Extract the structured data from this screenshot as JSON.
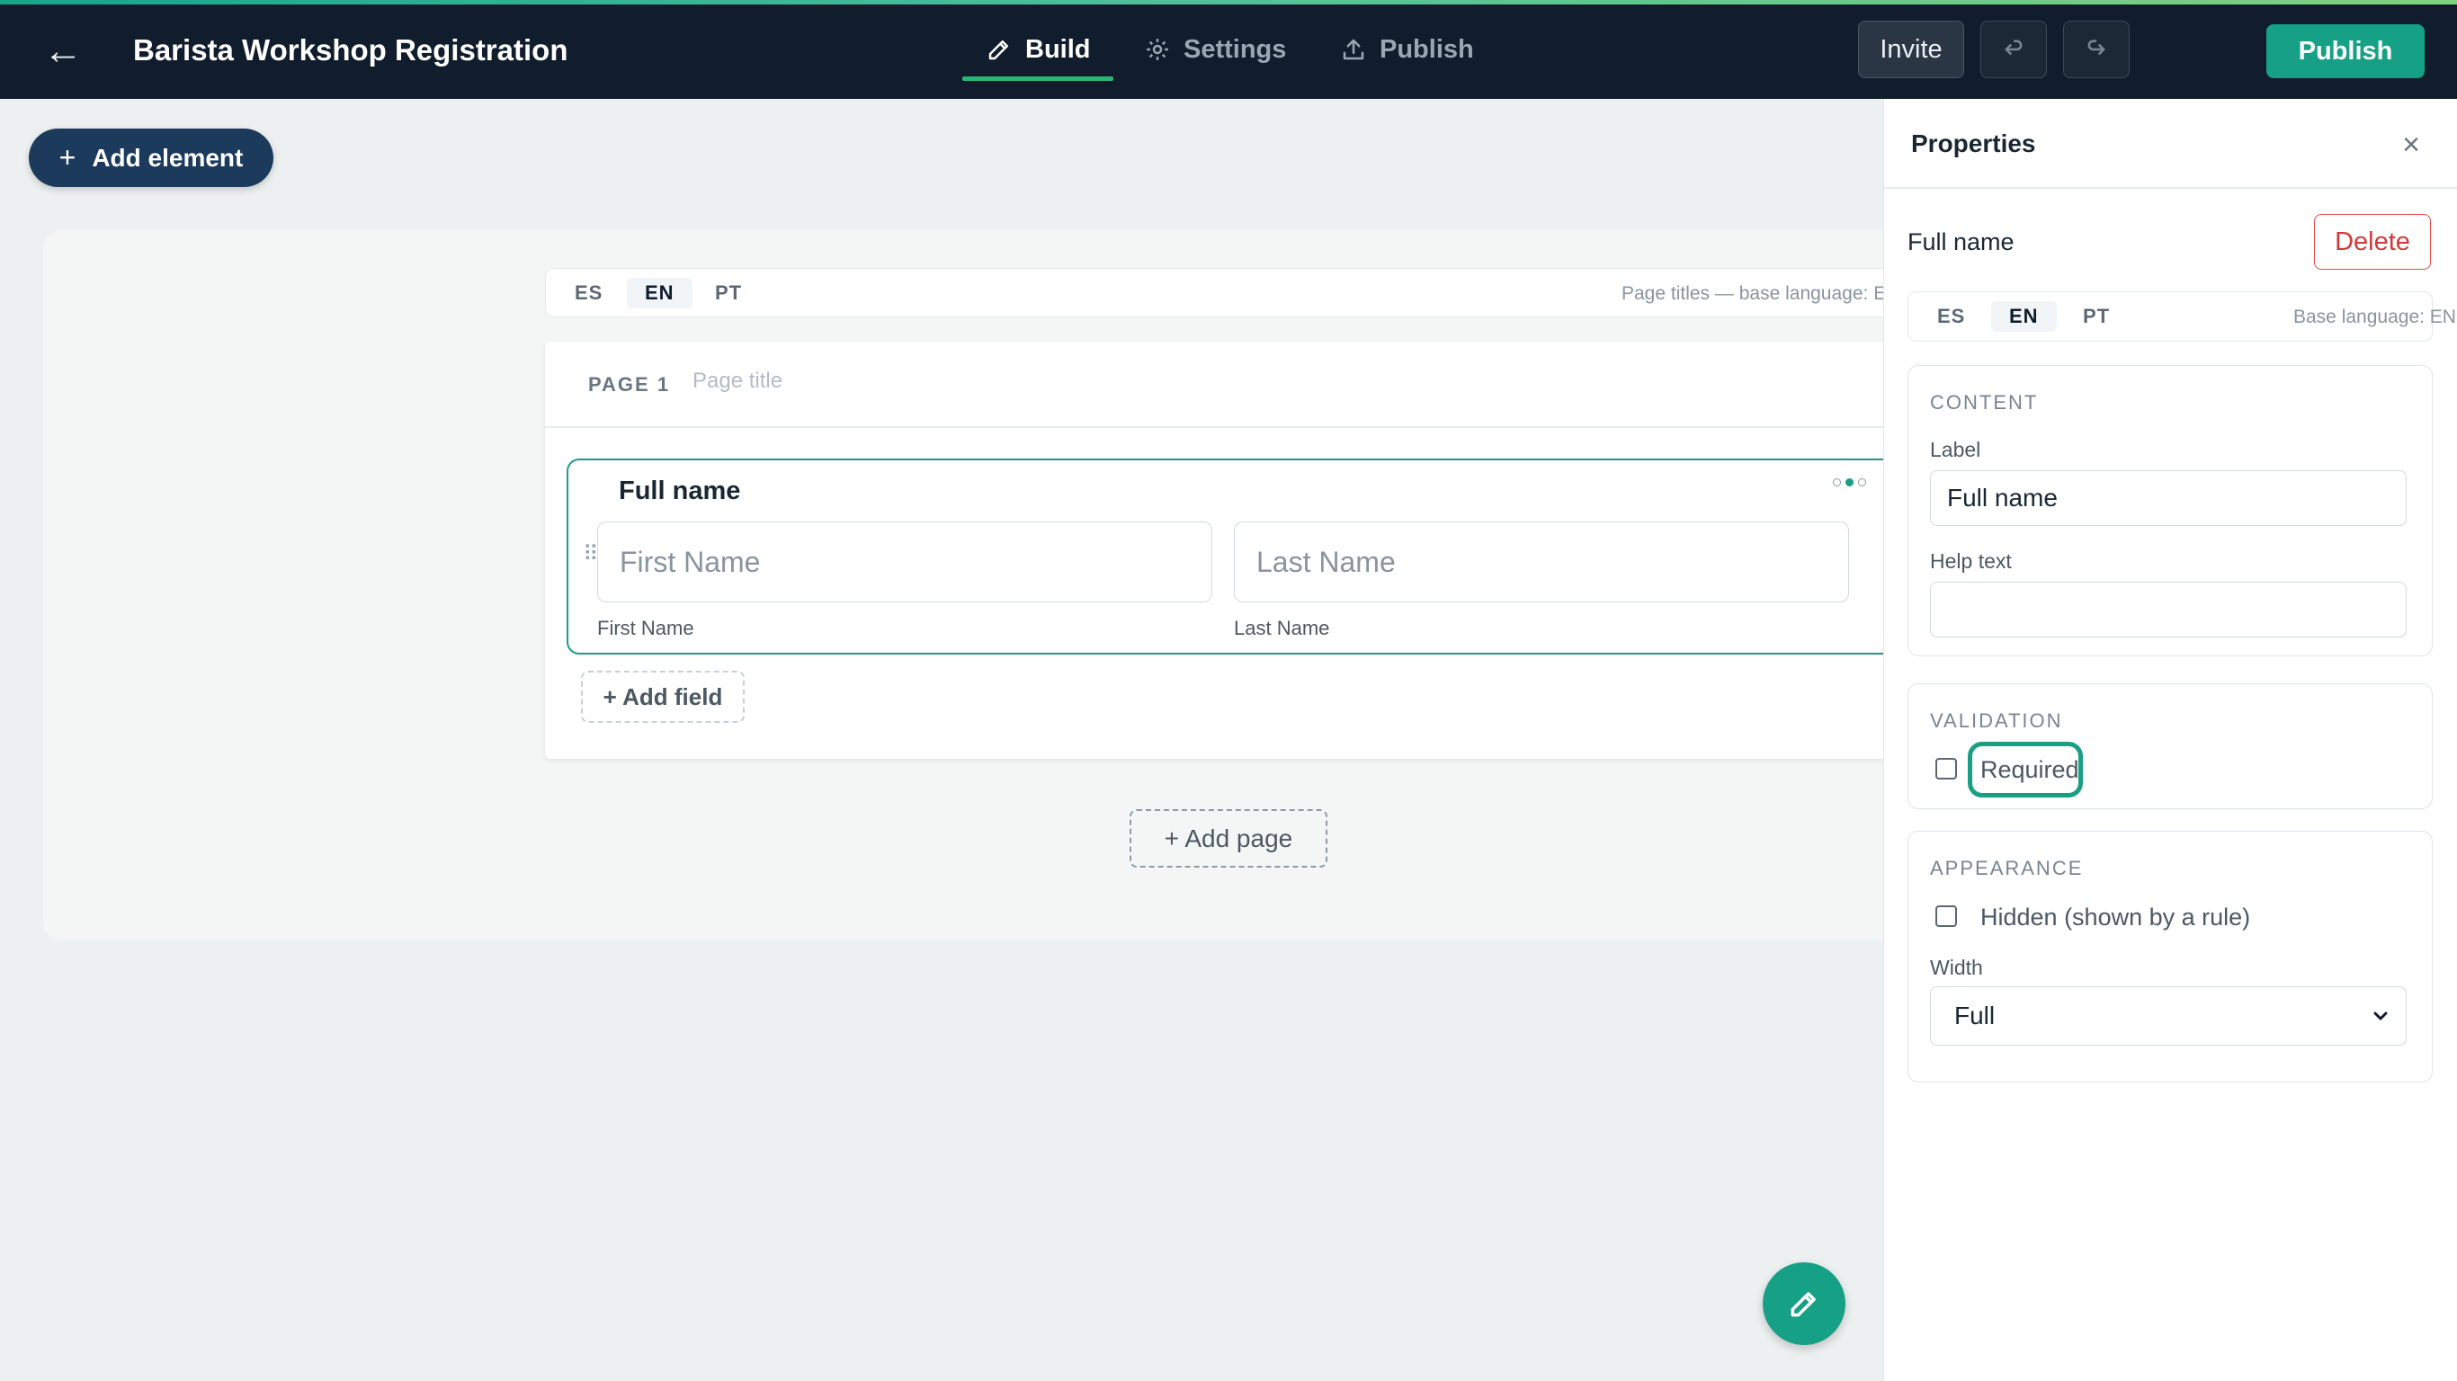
{
  "header": {
    "title": "Barista Workshop Registration",
    "tabs": [
      {
        "label": "Build",
        "icon": "pencil-icon",
        "active": true
      },
      {
        "label": "Settings",
        "icon": "gear-icon",
        "active": false
      },
      {
        "label": "Publish",
        "icon": "upload-icon",
        "active": false
      }
    ],
    "invite_label": "Invite",
    "publish_label": "Publish",
    "accent_color": "#16a085"
  },
  "toolbar": {
    "add_element_label": "Add element"
  },
  "canvas": {
    "languages": [
      "ES",
      "EN",
      "PT"
    ],
    "active_language": "EN",
    "lang_note": "Page titles — base language: EN",
    "page": {
      "number_label": "PAGE 1",
      "title_placeholder": "Page title",
      "field": {
        "title": "Full name",
        "inputs": [
          {
            "placeholder": "First Name",
            "label": "First Name"
          },
          {
            "placeholder": "Last Name",
            "label": "Last Name"
          }
        ]
      },
      "add_field_label": "+ Add field"
    },
    "add_page_label": "+ Add page"
  },
  "properties": {
    "title": "Properties",
    "element_name": "Full name",
    "delete_label": "Delete",
    "languages": [
      "ES",
      "EN",
      "PT"
    ],
    "lang_note": "Base language: EN",
    "content": {
      "heading": "CONTENT",
      "label_caption": "Label",
      "label_value": "Full name",
      "help_caption": "Help text",
      "help_value": ""
    },
    "validation": {
      "heading": "VALIDATION",
      "required_label": "Required",
      "required_checked": false
    },
    "appearance": {
      "heading": "APPEARANCE",
      "hidden_label": "Hidden (shown by a rule)",
      "hidden_checked": false,
      "width_caption": "Width",
      "width_value": "Full"
    }
  }
}
